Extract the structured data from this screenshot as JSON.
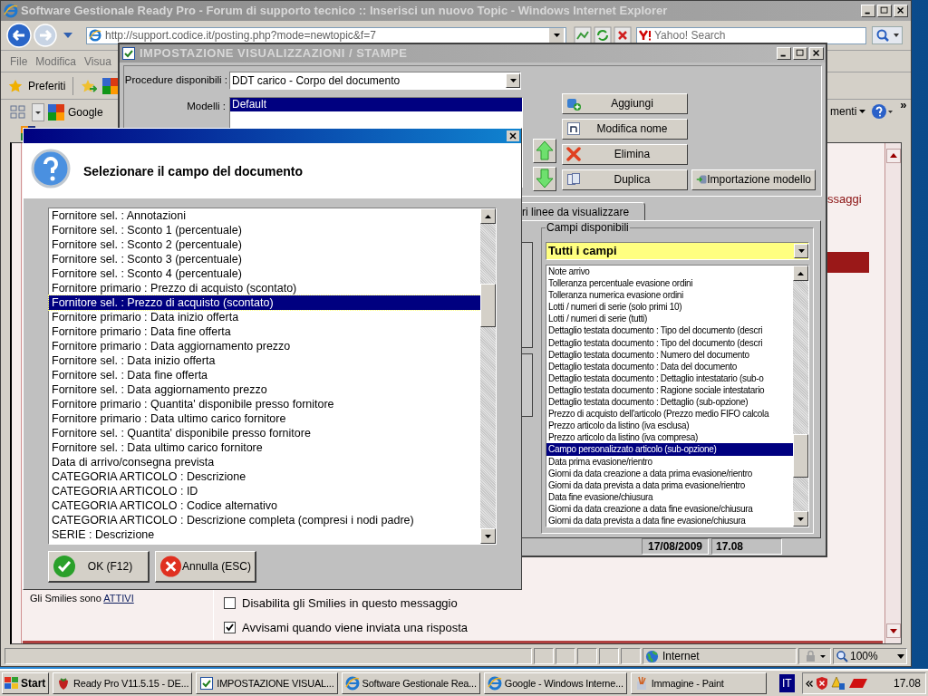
{
  "browser": {
    "title": "Software Gestionale Ready Pro - Forum di supporto tecnico :: Inserisci un nuovo Topic - Windows Internet Explorer",
    "address": "http://support.codice.it/posting.php?mode=newtopic&f=7",
    "search_placeholder": "Yahoo! Search",
    "menu": [
      "File",
      "Modifica",
      "Visua"
    ],
    "favorites_label": "Preferiti",
    "google_label": "Google",
    "tools_label": "menti",
    "more_label": "»",
    "page": {
      "side_text": "ssaggi",
      "smilies_text": "Gli Smilies sono",
      "smilies_link": "ATTIVI",
      "options": [
        {
          "label": "Disabilita gli Smilies in questo messaggio",
          "checked": false
        },
        {
          "label": "Avvisami quando viene inviata una risposta",
          "checked": true
        }
      ]
    },
    "status": {
      "zone": "Internet",
      "zoom": "100%"
    }
  },
  "settings_window": {
    "title": "IMPOSTAZIONE VISUALIZZAZIONI / STAMPE",
    "procedure_label": "Procedure disponibili :",
    "procedure_value": "DDT carico - Corpo del documento",
    "models_label": "Modelli :",
    "models": [
      {
        "label": "Default",
        "selected": true
      }
    ],
    "buttons": [
      {
        "label": "Aggiungi",
        "kind": "add"
      },
      {
        "label": "Modifica nome",
        "kind": "rename"
      },
      {
        "label": "Elimina",
        "kind": "delete"
      },
      {
        "label": "Duplica",
        "kind": "duplicate"
      },
      {
        "label": "Importazione modello",
        "kind": "import"
      }
    ],
    "tab_label": "ri linee da visualizzare",
    "group_label": "Campi disponibili",
    "filter_value": "Tutti i campi",
    "fields": [
      {
        "label": "Note arrivo",
        "selected": false
      },
      {
        "label": "Tolleranza percentuale evasione ordini",
        "selected": false
      },
      {
        "label": "Tolleranza numerica evasione ordini",
        "selected": false
      },
      {
        "label": "Lotti / numeri di serie (solo primi 10)",
        "selected": false
      },
      {
        "label": "Lotti / numeri di serie (tutti)",
        "selected": false
      },
      {
        "label": "Dettaglio testata documento : Tipo del documento (descri",
        "selected": false
      },
      {
        "label": "Dettaglio testata documento : Tipo del documento (descri",
        "selected": false
      },
      {
        "label": "Dettaglio testata documento : Numero del documento",
        "selected": false
      },
      {
        "label": "Dettaglio testata documento : Data del documento",
        "selected": false
      },
      {
        "label": "Dettaglio testata documento : Dettaglio intestatario (sub-o",
        "selected": false
      },
      {
        "label": "Dettaglio testata documento : Ragione sociale intestatario",
        "selected": false
      },
      {
        "label": "Dettaglio testata documento : Dettaglio (sub-opzione)",
        "selected": false
      },
      {
        "label": "Prezzo di acquisto dell'articolo (Prezzo medio FIFO calcola",
        "selected": false
      },
      {
        "label": "Prezzo articolo da listino (iva esclusa)",
        "selected": false
      },
      {
        "label": "Prezzo articolo da listino (iva compresa)",
        "selected": false
      },
      {
        "label": "Campo personalizzato articolo (sub-opzione)",
        "selected": true
      },
      {
        "label": "Data prima evasione/rientro",
        "selected": false
      },
      {
        "label": "Giorni da data creazione a data prima evasione/rientro",
        "selected": false
      },
      {
        "label": "Giorni da data prevista a data prima evasione/rientro",
        "selected": false
      },
      {
        "label": "Data fine evasione/chiusura",
        "selected": false
      },
      {
        "label": "Giorni da data creazione a data fine evasione/chiusura",
        "selected": false
      },
      {
        "label": "Giorni da data prevista a data fine evasione/chiusura",
        "selected": false
      }
    ],
    "status_date": "17/08/2009",
    "status_time": "17.08"
  },
  "dialog": {
    "heading": "Selezionare il campo del documento",
    "items": [
      {
        "label": "Fornitore sel. : Annotazioni",
        "selected": false
      },
      {
        "label": "Fornitore sel. : Sconto 1 (percentuale)",
        "selected": false
      },
      {
        "label": "Fornitore sel. : Sconto 2 (percentuale)",
        "selected": false
      },
      {
        "label": "Fornitore sel. : Sconto 3 (percentuale)",
        "selected": false
      },
      {
        "label": "Fornitore sel. : Sconto 4 (percentuale)",
        "selected": false
      },
      {
        "label": "Fornitore primario : Prezzo di acquisto (scontato)",
        "selected": false
      },
      {
        "label": "Fornitore sel. : Prezzo di acquisto (scontato)",
        "selected": true
      },
      {
        "label": "Fornitore primario : Data inizio offerta",
        "selected": false
      },
      {
        "label": "Fornitore primario : Data fine offerta",
        "selected": false
      },
      {
        "label": "Fornitore primario : Data aggiornamento prezzo",
        "selected": false
      },
      {
        "label": "Fornitore sel. : Data inizio offerta",
        "selected": false
      },
      {
        "label": "Fornitore sel. : Data fine offerta",
        "selected": false
      },
      {
        "label": "Fornitore sel. : Data aggiornamento prezzo",
        "selected": false
      },
      {
        "label": "Fornitore primario : Quantita' disponibile presso fornitore",
        "selected": false
      },
      {
        "label": "Fornitore primario : Data ultimo carico fornitore",
        "selected": false
      },
      {
        "label": "Fornitore sel. : Quantita' disponibile presso fornitore",
        "selected": false
      },
      {
        "label": "Fornitore sel. : Data ultimo carico fornitore",
        "selected": false
      },
      {
        "label": "Data di arrivo/consegna prevista",
        "selected": false
      },
      {
        "label": "CATEGORIA ARTICOLO : Descrizione",
        "selected": false
      },
      {
        "label": "CATEGORIA ARTICOLO : ID",
        "selected": false
      },
      {
        "label": "CATEGORIA ARTICOLO : Codice alternativo",
        "selected": false
      },
      {
        "label": "CATEGORIA ARTICOLO : Descrizione completa (compresi i nodi padre)",
        "selected": false
      },
      {
        "label": "SERIE : Descrizione",
        "selected": false
      }
    ],
    "buttons": [
      {
        "label": "OK (F12)",
        "kind": "ok"
      },
      {
        "label": "Annulla (ESC)",
        "kind": "cancel"
      }
    ]
  },
  "taskbar": {
    "start": "Start",
    "tasks": [
      {
        "label": "Ready Pro V11.5.15 - DE...",
        "kind": "app"
      },
      {
        "label": "IMPOSTAZIONE VISUAL...",
        "kind": "settings"
      },
      {
        "label": "Software Gestionale Rea...",
        "kind": "browser"
      },
      {
        "label": "Google - Windows Interne...",
        "kind": "browser"
      },
      {
        "label": "Immagine - Paint",
        "kind": "paint"
      }
    ],
    "language": "IT",
    "clock": "17.08"
  }
}
